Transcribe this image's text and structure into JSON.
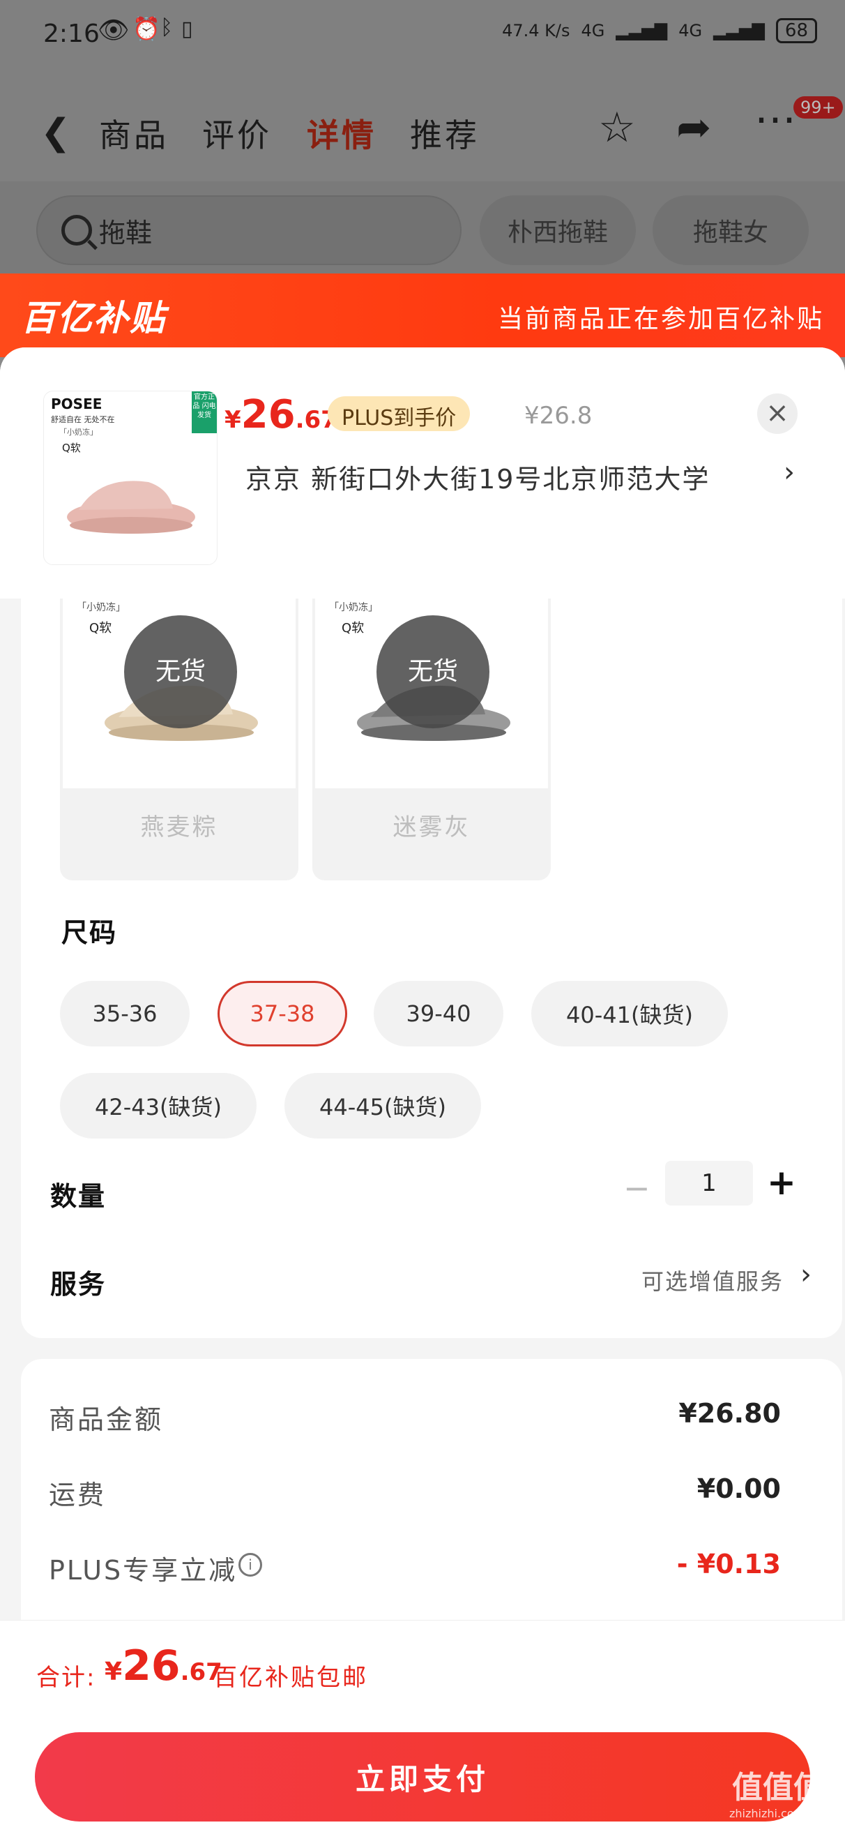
{
  "status_bar": {
    "time": "2:16",
    "network_speed": "47.4 K/s",
    "net1": "4G",
    "net2": "4G",
    "battery": "68"
  },
  "nav": {
    "tabs": [
      "商品",
      "评价",
      "详情",
      "推荐"
    ],
    "active_tab": "详情",
    "badge": "99+"
  },
  "search": {
    "placeholder": "拖鞋",
    "chips": [
      "朴西拖鞋",
      "拖鞋女"
    ]
  },
  "banner": {
    "logo": "百亿补贴",
    "note": "当前商品正在参加百亿补贴"
  },
  "product": {
    "thumb_brand": "POSEE",
    "thumb_tagline": "舒适自在 无处不在",
    "thumb_badge": "官方正品 闪电发货",
    "thumb_small": "「小奶冻」",
    "thumb_q": "Q软",
    "price_currency": "¥",
    "price_int": "26",
    "price_dec": ".67",
    "plus_tag": "PLUS到手价",
    "orig_price": "¥26.8",
    "address": "京京   新街口外大街19号北京师范大学"
  },
  "colors": [
    {
      "name": "燕麦粽",
      "status": "无货",
      "tiny": "「小奶冻」",
      "q": "Q软",
      "shoe_color": "#e3d3bb"
    },
    {
      "name": "迷雾灰",
      "status": "无货",
      "tiny": "「小奶冻」",
      "q": "Q软",
      "shoe_color": "#8e8e8e"
    }
  ],
  "size": {
    "title": "尺码",
    "options": [
      "35-36",
      "37-38",
      "39-40",
      "40-41(缺货)",
      "42-43(缺货)",
      "44-45(缺货)"
    ],
    "selected": "37-38"
  },
  "quantity": {
    "title": "数量",
    "value": "1",
    "minus": "−",
    "plus": "+"
  },
  "service": {
    "title": "服务",
    "note": "可选增值服务"
  },
  "summary": {
    "rows": [
      {
        "label": "商品金额",
        "value": "¥26.80"
      },
      {
        "label": "运费",
        "value": "¥0.00"
      },
      {
        "label": "PLUS专享立减",
        "value": "- ¥0.13"
      }
    ]
  },
  "footer": {
    "total_label": "合计:",
    "total_currency": "¥",
    "total_int": "26",
    "total_dec": ".67",
    "total_note": "百亿补贴包邮",
    "pay_button": "立即支付"
  },
  "watermark": {
    "text": "值值值",
    "sub": "zhizhizhi.com"
  },
  "colors_theme": {
    "accent": "#e8261c",
    "banner": "#ff4a1a"
  }
}
